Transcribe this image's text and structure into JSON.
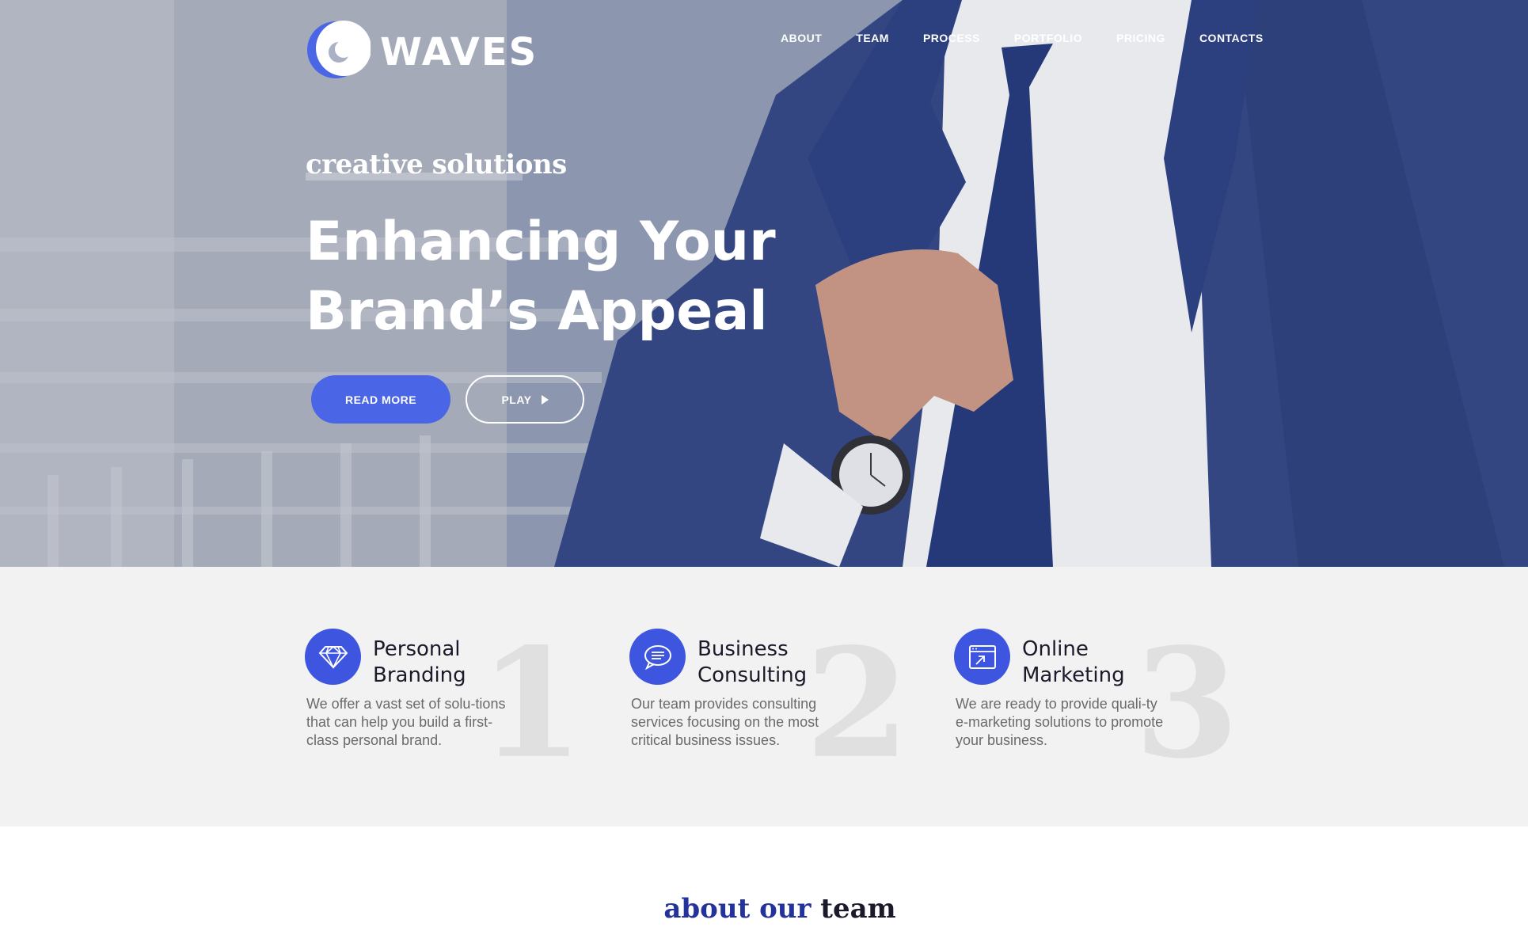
{
  "brand": {
    "name": "WAVES",
    "logo_icon": "crescent-wave-logo"
  },
  "nav": {
    "items": [
      {
        "label": "ABOUT"
      },
      {
        "label": "TEAM"
      },
      {
        "label": "PROCESS"
      },
      {
        "label": "PORTFOLIO"
      },
      {
        "label": "PRICING"
      },
      {
        "label": "CONTACTS"
      }
    ]
  },
  "hero": {
    "eyebrow": "creative solutions",
    "headline_line1": "Enhancing Your",
    "headline_line2": "Brand’s Appeal",
    "primary_button": "READ MORE",
    "secondary_button": "PLAY",
    "secondary_icon": "play-icon"
  },
  "features": [
    {
      "number": "1",
      "icon": "diamond-icon",
      "title_line1": "Personal",
      "title_line2": "Branding",
      "text": "We offer a vast set of solu-tions that can help you build a first-class personal brand."
    },
    {
      "number": "2",
      "icon": "chat-bubble-icon",
      "title_line1": "Business",
      "title_line2": "Consulting",
      "text": "Our team provides consulting services focusing on the most critical business issues."
    },
    {
      "number": "3",
      "icon": "browser-window-icon",
      "title_line1": "Online",
      "title_line2": "Marketing",
      "text": "We are ready to provide quali-ty  e-marketing solutions to promote your business."
    }
  ],
  "about": {
    "title_part1": "about our",
    "title_part2": "team"
  },
  "colors": {
    "accent": "#4a66e6",
    "icon_bg": "#3d55df",
    "navy": "#23339b",
    "features_bg": "#f2f2f2"
  }
}
